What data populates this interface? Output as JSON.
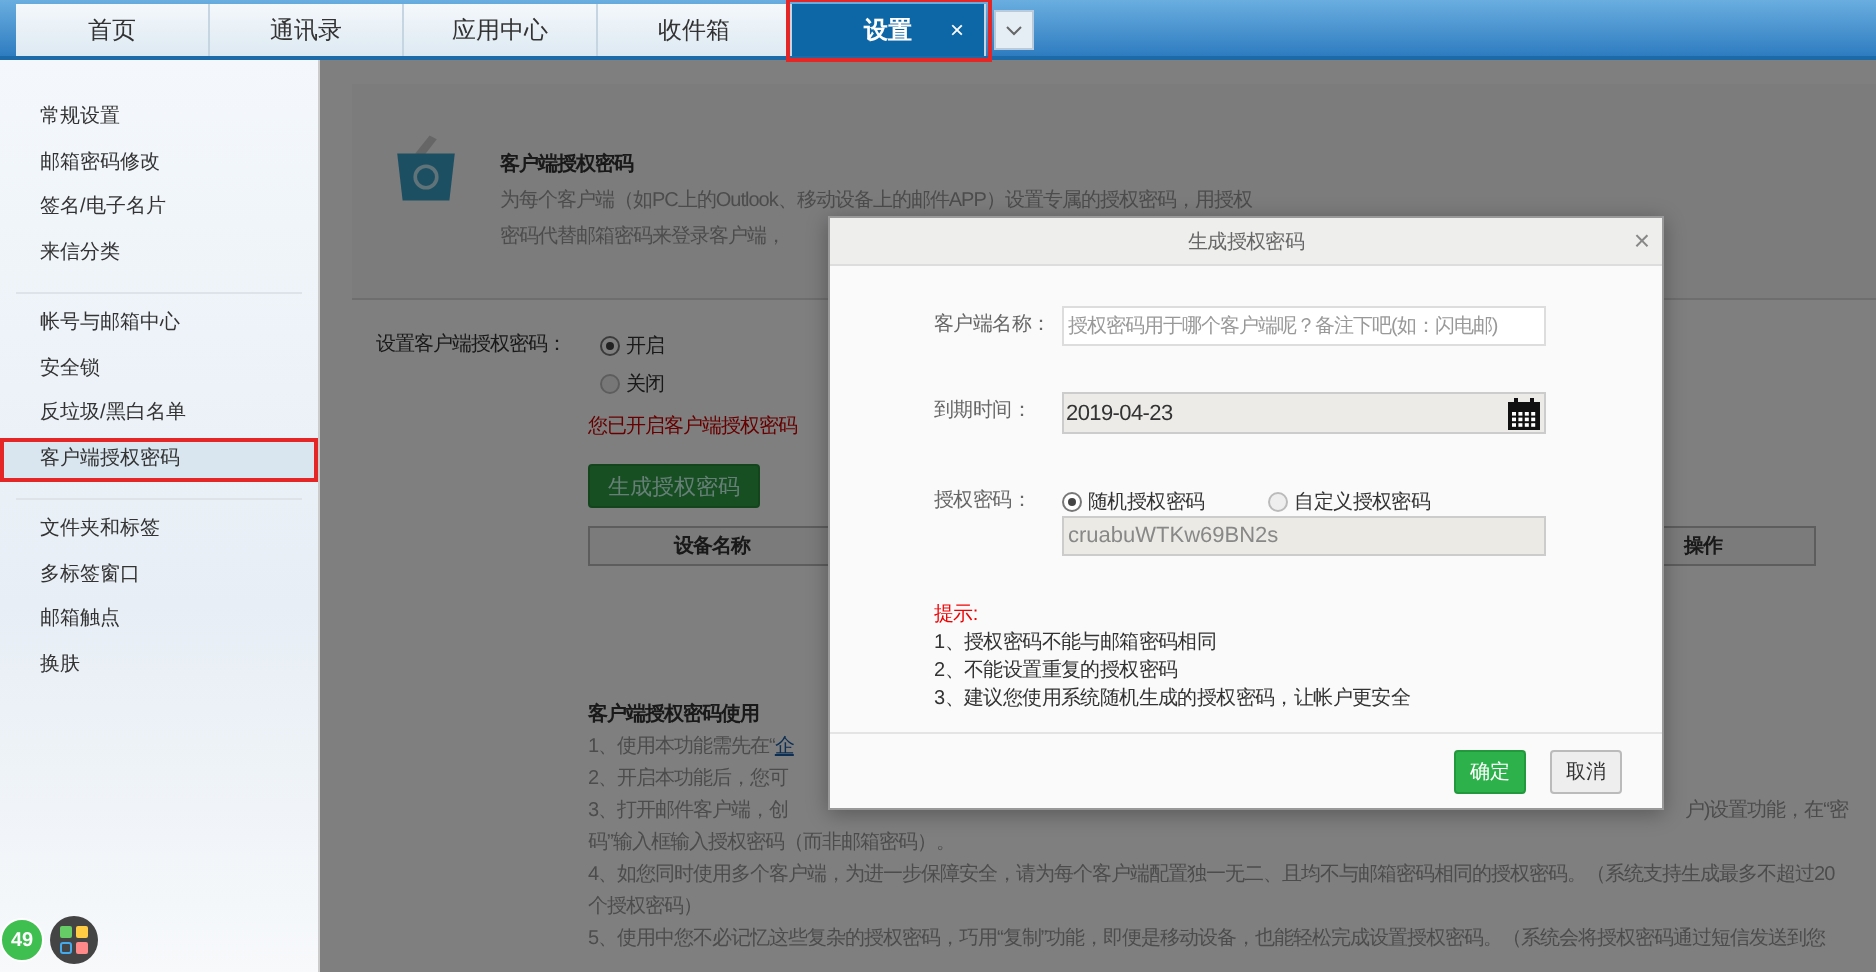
{
  "tabs": [
    {
      "label": "首页",
      "selected": false,
      "highlighted": false
    },
    {
      "label": "通讯录",
      "selected": false,
      "highlighted": false
    },
    {
      "label": "应用中心",
      "selected": false,
      "highlighted": false
    },
    {
      "label": "收件箱",
      "selected": false,
      "highlighted": false
    },
    {
      "label": "设置",
      "selected": true,
      "highlighted": true,
      "close": "×"
    }
  ],
  "sidebar": {
    "groups": [
      {
        "items": [
          {
            "label": "常规设置",
            "selected": false,
            "highlighted": false
          },
          {
            "label": "邮箱密码修改",
            "selected": false,
            "highlighted": false
          },
          {
            "label": "签名/电子名片",
            "selected": false,
            "highlighted": false
          },
          {
            "label": "来信分类",
            "selected": false,
            "highlighted": false
          }
        ]
      },
      {
        "items": [
          {
            "label": "帐号与邮箱中心",
            "selected": false,
            "highlighted": false
          },
          {
            "label": "安全锁",
            "selected": false,
            "highlighted": false
          },
          {
            "label": "反垃圾/黑白名单",
            "selected": false,
            "highlighted": false
          },
          {
            "label": "客户端授权密码",
            "selected": true,
            "highlighted": true
          }
        ]
      },
      {
        "items": [
          {
            "label": "文件夹和标签",
            "selected": false,
            "highlighted": false
          },
          {
            "label": "多标签窗口",
            "selected": false,
            "highlighted": false
          },
          {
            "label": "邮箱触点",
            "selected": false,
            "highlighted": false
          },
          {
            "label": "换肤",
            "selected": false,
            "highlighted": false
          }
        ]
      }
    ]
  },
  "page": {
    "title": "客户端授权密码",
    "description": [
      "为每个客户端（如PC上的Outlook、移动设备上的邮件APP）设置专属的授权密码，用授权",
      "密码代替邮箱密码来登录客户端，"
    ],
    "setting": {
      "label": "设置客户端授权密码：",
      "options": [
        {
          "label": "开启",
          "selected": true
        },
        {
          "label": "关闭",
          "selected": false
        }
      ],
      "status": "您已开启客户端授权密码",
      "button": "生成授权密码"
    },
    "table": {
      "columns": [
        "设备名称",
        "操作"
      ]
    },
    "guide": {
      "title": "客户端授权密码使用",
      "lines": [
        {
          "kind": "link",
          "text": "1、使用本功能需先在“",
          "link": "企"
        },
        {
          "kind": "text",
          "text": "2、开启本功能后，您可"
        },
        {
          "kind": "split",
          "text": "3、打开邮件客户端，创",
          "right": "户)设置功能，在“密"
        },
        {
          "kind": "text",
          "text": "码”输入框输入授权密码（而非邮箱密码）。"
        },
        {
          "kind": "text",
          "text": "4、如您同时使用多个客户端，为进一步保障安全，请为每个客户端配置独一无二、且均不与邮箱密码相同的授权密码。（系统支持生成最多不超过20"
        },
        {
          "kind": "text",
          "text": "个授权密码）"
        },
        {
          "kind": "text",
          "text": "5、使用中您不必记忆这些复杂的授权密码，巧用“复制”功能，即便是移动设备，也能轻松完成设置授权密码。（系统会将授权密码通过短信发送到您"
        }
      ]
    }
  },
  "dock": {
    "badge": "49"
  },
  "dialog": {
    "title": "生成授权密码",
    "close": "×",
    "fields": [
      {
        "kind": "input",
        "label": "客户端名称：",
        "placeholder": "授权密码用于哪个客户端呢？备注下吧(如：闪电邮)"
      },
      {
        "kind": "date",
        "label": "到期时间：",
        "value": "2019-04-23"
      },
      {
        "kind": "choice",
        "label": "授权密码：",
        "options": [
          {
            "label": "随机授权密码",
            "selected": true
          },
          {
            "label": "自定义授权密码",
            "selected": false
          }
        ],
        "value": "cruabuWTKw69BN2s"
      }
    ],
    "tips": {
      "title": "提示:",
      "lines": [
        "1、授权密码不能与邮箱密码相同",
        "2、不能设置重复的授权密码",
        "3、建议您使用系统随机生成的授权密码，让帐户更安全"
      ]
    },
    "buttons": [
      {
        "label": "确定",
        "kind": "primary"
      },
      {
        "label": "取消",
        "kind": "default"
      }
    ]
  }
}
